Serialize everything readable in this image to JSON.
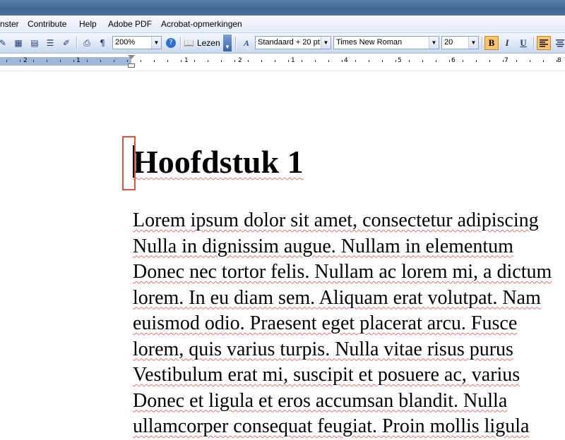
{
  "menu": {
    "items": [
      {
        "label": "nster",
        "underline": ""
      },
      {
        "label": "Contribute",
        "underline": ""
      },
      {
        "label": "Help",
        "underline": ""
      },
      {
        "label": "Adobe PDF",
        "underline": ""
      },
      {
        "label": "Acrobat-opmerkingen",
        "underline": ""
      }
    ]
  },
  "toolbar": {
    "zoom_value": "200%",
    "read_label": "Lezen",
    "style_value": "Standaard + 20 pt",
    "font_value": "Times New Roman",
    "size_value": "20",
    "bold_label": "B",
    "italic_label": "I",
    "underline_label": "U",
    "accent_color": "#fbc36a"
  },
  "ruler": {
    "labels": [
      "2",
      "1",
      "1",
      "1",
      "2",
      "3",
      "4",
      "5",
      "6",
      "7",
      "8"
    ]
  },
  "document": {
    "heading": "Hoofdstuk 1",
    "lines": [
      "Lorem ipsum dolor sit amet, consectetur adipiscing",
      "Nulla in dignissim augue. Nullam in elementum",
      "Donec nec tortor felis. Nullam ac lorem mi, a dictum",
      "lorem. In eu diam sem. Aliquam erat volutpat. Nam",
      "euismod odio. Praesent eget placerat arcu. Fusce",
      "lorem, quis varius turpis. Nulla vitae risus purus",
      "Vestibulum erat mi, suscipit et posuere ac, varius",
      "Donec et ligula et eros accumsan blandit. Nulla",
      "ullamcorper consequat feugiat. Proin mollis ligula"
    ]
  }
}
